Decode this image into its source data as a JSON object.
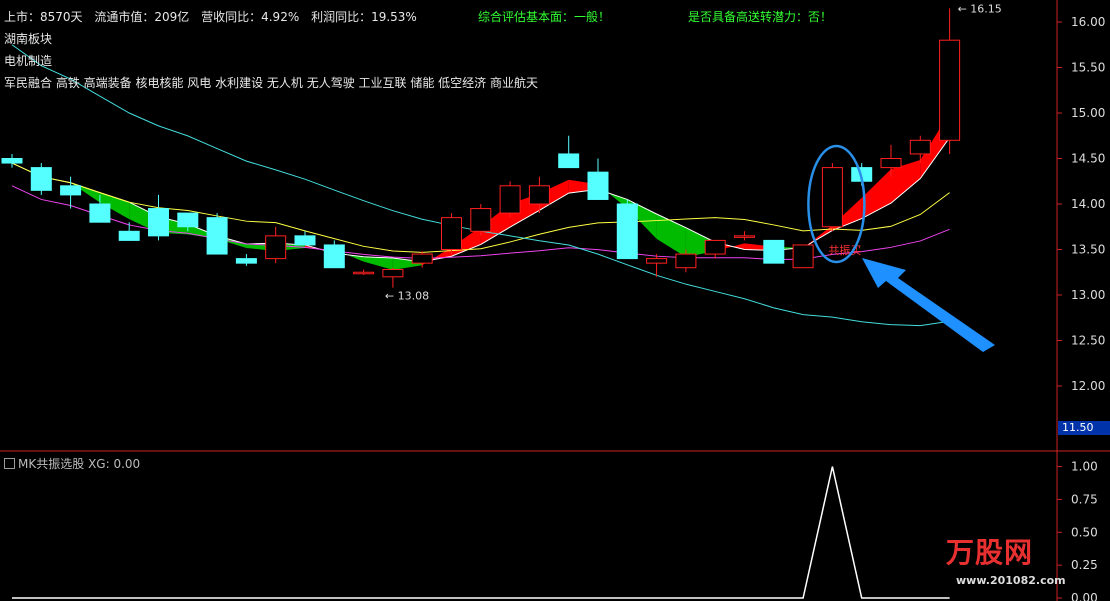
{
  "header": {
    "list_date": "上市：8570天",
    "market_cap": "流通市值：209亿",
    "revenue_yoy": "营收同比：4.92%",
    "profit_yoy": "利润同比：19.53%",
    "assessment_fundamental": "综合评估基本面：一般！",
    "assessment_potential": "是否具备高送转潜力：否！"
  },
  "sectors": [
    "湖南板块",
    "电机制造",
    "军民融合 高铁 高端装备 核电核能 风电 水利建设 无人机 无人驾驶 工业互联 储能 低空经济 商业航天"
  ],
  "indicator": {
    "name": "MK共振选股",
    "xg_label": "XG: 0.00"
  },
  "annotations": {
    "high_label": "16.15",
    "low_label": "13.08",
    "buy_signal": "共振买",
    "current_price": "11.50"
  },
  "watermark": {
    "brand": "万股网",
    "url": "www.201082.com"
  },
  "colors": {
    "up": "#ff2020",
    "down": "#55ffff",
    "band_up": "#ff0000",
    "band_down": "#00bb00",
    "white_line": "#ffffff",
    "yellow_line": "#ffff44",
    "magenta_line": "#ee44ee",
    "cyan_line": "#44dddd",
    "axis": "#cc2222",
    "circle": "#2a8fe8",
    "arrow": "#1e90ff"
  },
  "chart_data": {
    "type": "candlestick",
    "yaxis_main": {
      "ticks": [
        12.0,
        12.5,
        13.0,
        13.5,
        14.0,
        14.5,
        15.0,
        15.5,
        16.0
      ],
      "ylim": [
        11.4,
        16.25
      ]
    },
    "yaxis_sub": {
      "ticks": [
        0.0,
        0.25,
        0.5,
        0.75,
        1.0
      ],
      "ylim": [
        0,
        1.05
      ]
    },
    "candles": [
      [
        14.5,
        14.55,
        14.4,
        14.45
      ],
      [
        14.4,
        14.45,
        14.1,
        14.15
      ],
      [
        14.2,
        14.3,
        13.95,
        14.1
      ],
      [
        14.0,
        14.1,
        13.8,
        13.8
      ],
      [
        13.7,
        13.8,
        13.6,
        13.6
      ],
      [
        13.95,
        14.1,
        13.6,
        13.65
      ],
      [
        13.9,
        13.9,
        13.7,
        13.75
      ],
      [
        13.85,
        13.9,
        13.45,
        13.45
      ],
      [
        13.4,
        13.45,
        13.32,
        13.35
      ],
      [
        13.4,
        13.75,
        13.35,
        13.65
      ],
      [
        13.65,
        13.7,
        13.55,
        13.55
      ],
      [
        13.55,
        13.6,
        13.3,
        13.3
      ],
      [
        13.25,
        13.28,
        13.22,
        13.25
      ],
      [
        13.2,
        13.3,
        13.08,
        13.28
      ],
      [
        13.35,
        13.48,
        13.3,
        13.45
      ],
      [
        13.5,
        13.9,
        13.45,
        13.85
      ],
      [
        13.7,
        14.0,
        13.65,
        13.95
      ],
      [
        13.9,
        14.25,
        13.85,
        14.2
      ],
      [
        14.0,
        14.3,
        13.9,
        14.2
      ],
      [
        14.55,
        14.75,
        14.4,
        14.4
      ],
      [
        14.35,
        14.5,
        14.05,
        14.05
      ],
      [
        14.0,
        14.05,
        13.4,
        13.4
      ],
      [
        13.35,
        13.45,
        13.2,
        13.4
      ],
      [
        13.3,
        13.5,
        13.25,
        13.45
      ],
      [
        13.45,
        13.6,
        13.4,
        13.6
      ],
      [
        13.65,
        13.7,
        13.6,
        13.65
      ],
      [
        13.6,
        13.6,
        13.35,
        13.35
      ],
      [
        13.3,
        13.55,
        13.3,
        13.55
      ],
      [
        13.75,
        14.45,
        13.7,
        14.4
      ],
      [
        14.4,
        14.45,
        14.2,
        14.25
      ],
      [
        14.4,
        14.65,
        14.3,
        14.5
      ],
      [
        14.55,
        14.75,
        14.45,
        14.7
      ],
      [
        14.7,
        16.15,
        14.55,
        15.8
      ]
    ],
    "signal": [
      0,
      0,
      0,
      0,
      0,
      0,
      0,
      0,
      0,
      0,
      0,
      0,
      0,
      0,
      0,
      0,
      0,
      0,
      0,
      0,
      0,
      0,
      0,
      0,
      0,
      0,
      0,
      0,
      1,
      0,
      0,
      0,
      0
    ]
  }
}
